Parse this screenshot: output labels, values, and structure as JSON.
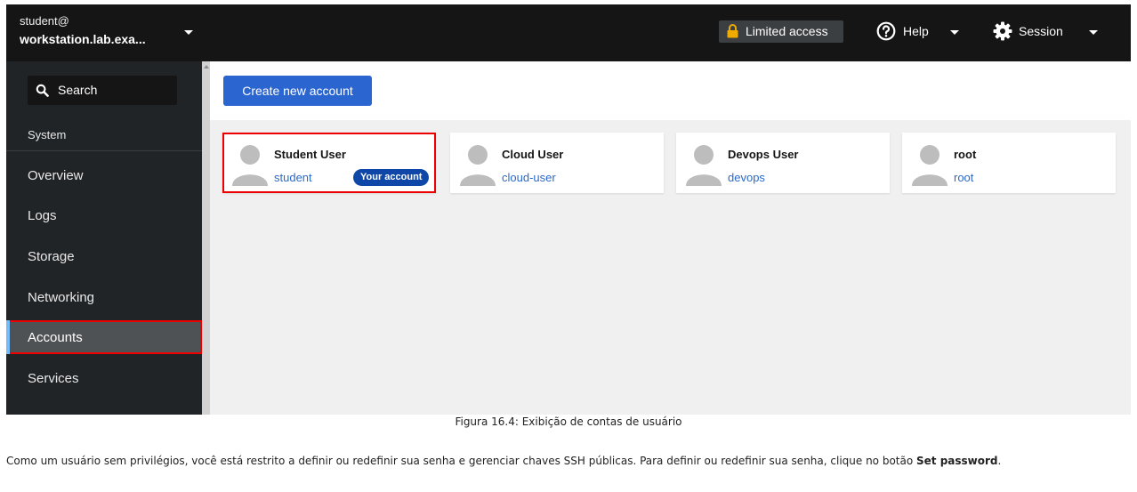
{
  "host": {
    "user": "student@",
    "name": "workstation.lab.exa..."
  },
  "search": {
    "label": "Search",
    "icon": "search-icon"
  },
  "nav": {
    "section": "System",
    "items": [
      {
        "label": "Overview"
      },
      {
        "label": "Logs"
      },
      {
        "label": "Storage"
      },
      {
        "label": "Networking"
      },
      {
        "label": "Accounts",
        "active": true
      },
      {
        "label": "Services"
      }
    ]
  },
  "topbar": {
    "limited_access": "Limited access",
    "help": "Help",
    "session": "Session",
    "icons": [
      "lock-icon",
      "help-icon",
      "gear-icon"
    ]
  },
  "main": {
    "create_button": "Create new account",
    "accounts": [
      {
        "name": "Student User",
        "login": "student",
        "badge": "Your account"
      },
      {
        "name": "Cloud User",
        "login": "cloud-user"
      },
      {
        "name": "Devops User",
        "login": "devops"
      },
      {
        "name": "root",
        "login": "root"
      }
    ]
  },
  "caption": "Figura 16.4: Exibição de contas de usuário",
  "paragraph": {
    "text": "Como um usuário sem privilégios, você está restrito a definir ou redefinir sua senha e gerenciar chaves SSH públicas. Para definir ou redefinir sua senha, clique no botão ",
    "bold": "Set password",
    "end": "."
  },
  "colors": {
    "sidebar": "#212427",
    "topbar": "#151515",
    "primary": "#2a65d0",
    "link": "#2b6ac8",
    "badge": "#0e47a8",
    "highlight": "#ee0000",
    "lock": "#f0ab00"
  }
}
